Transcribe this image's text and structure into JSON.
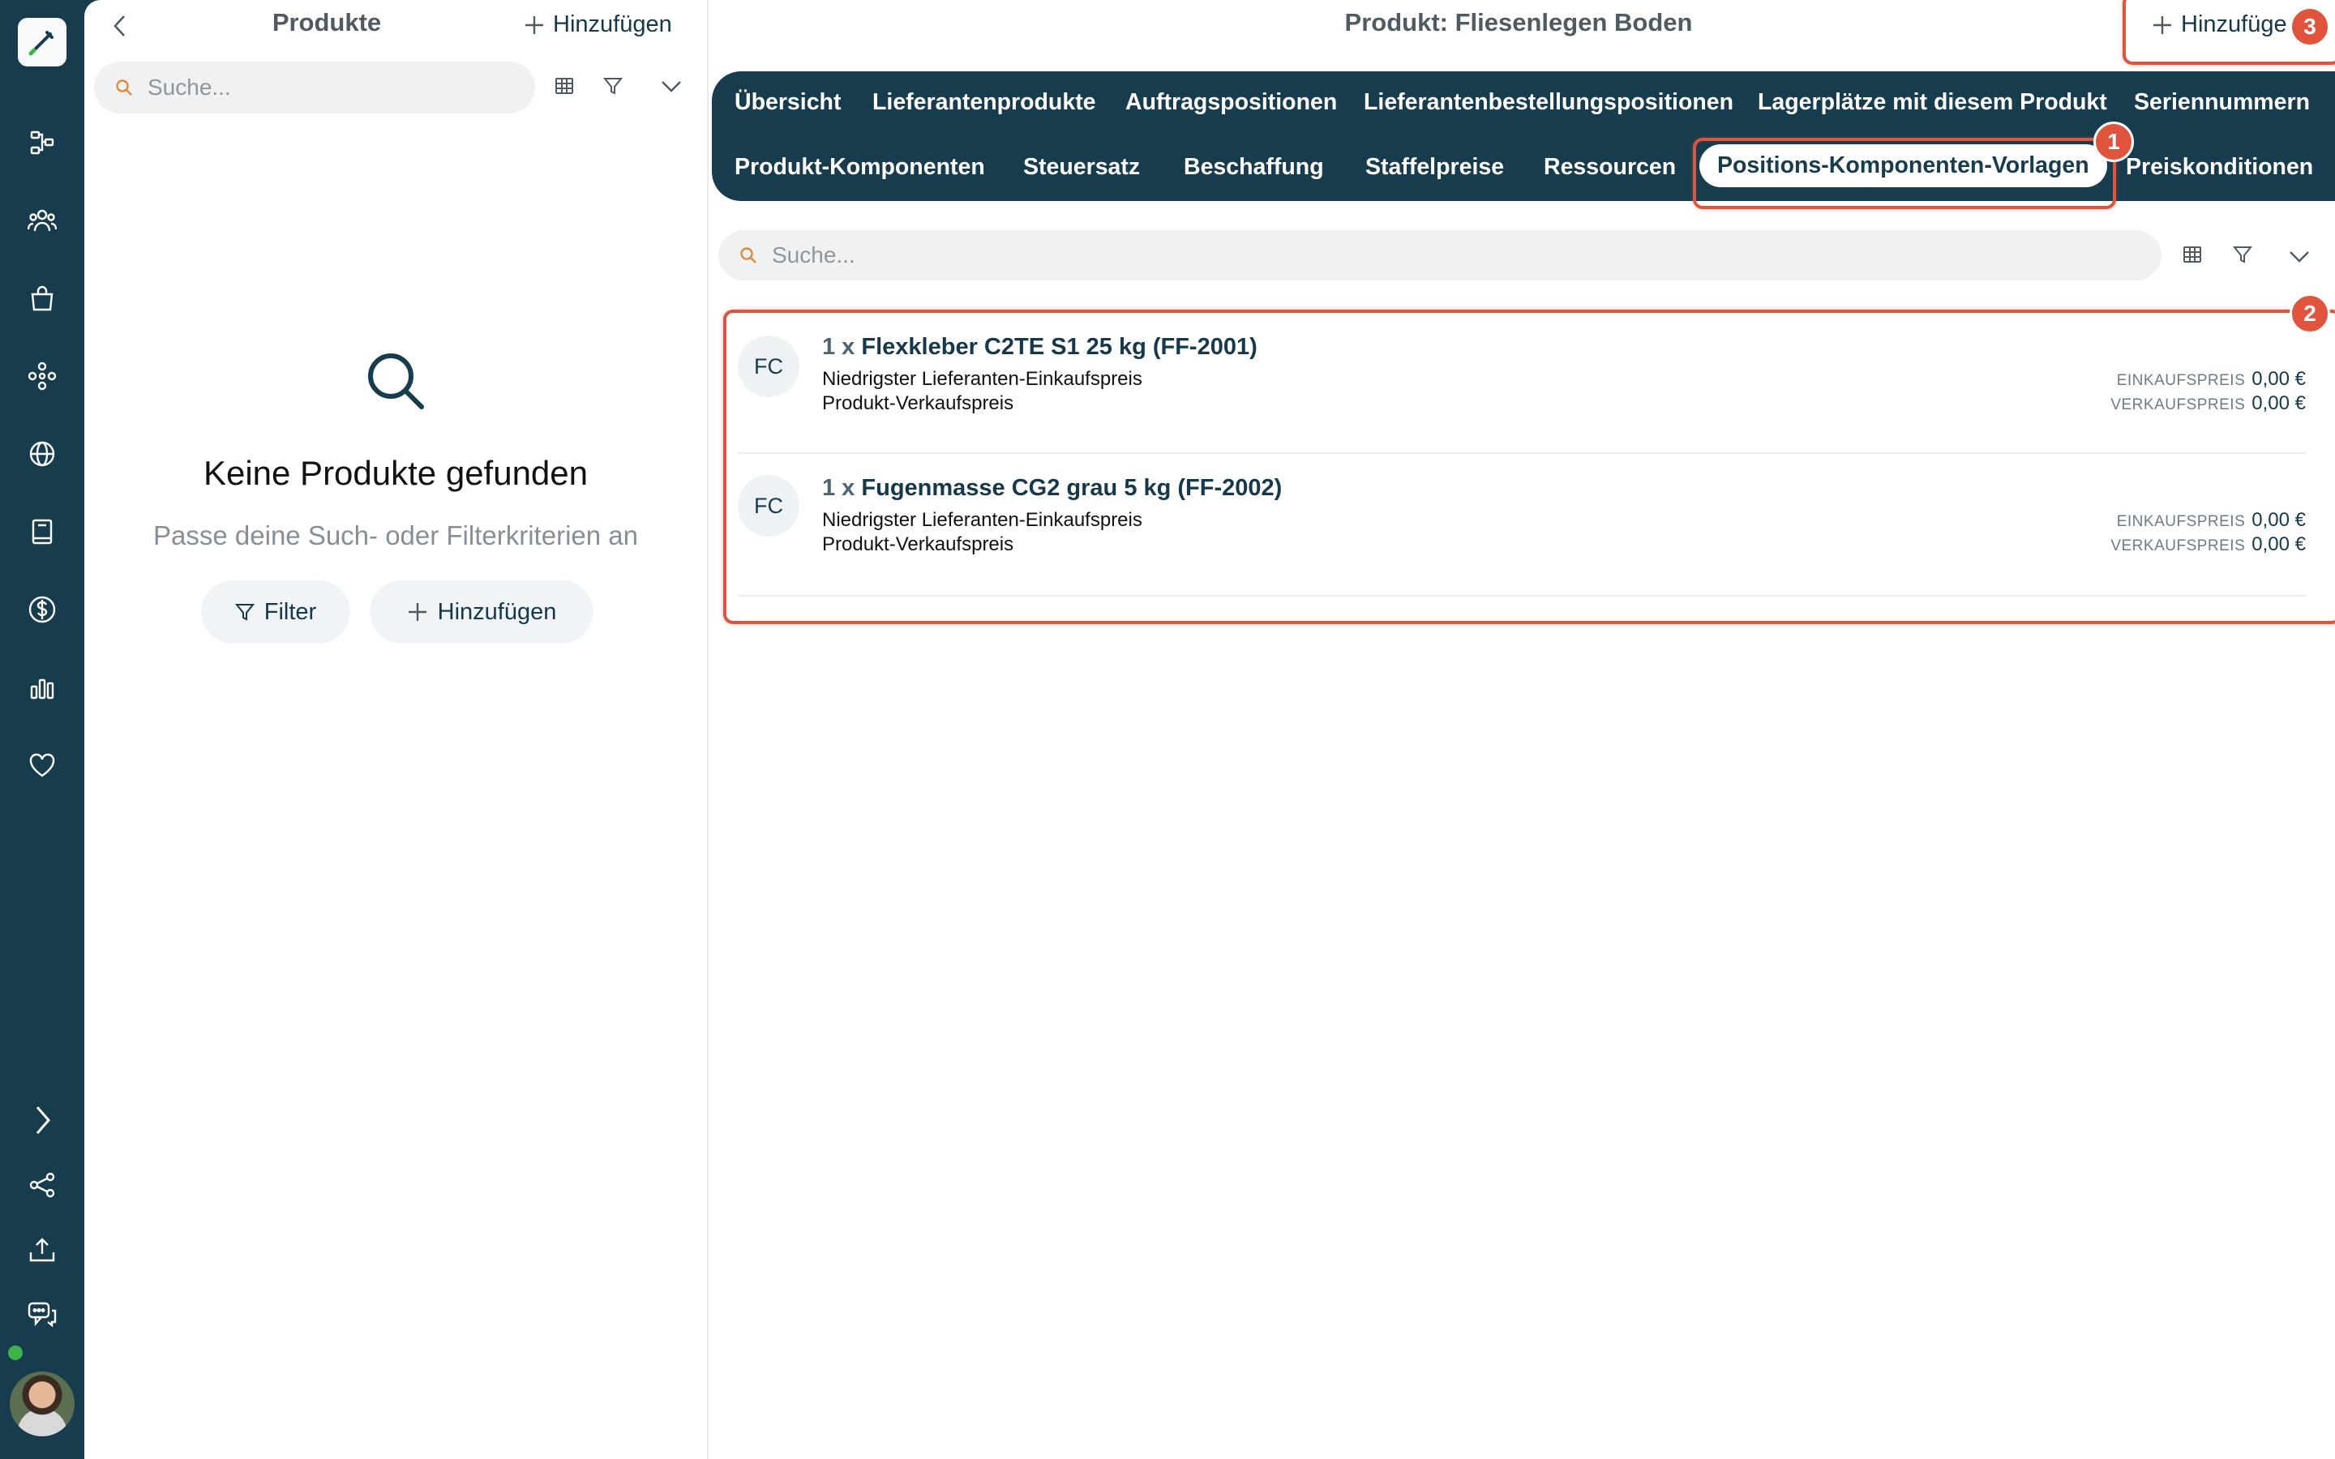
{
  "colors": {
    "rail": "#173c4e",
    "accent": "#e0533d",
    "text": "#15384a"
  },
  "rail": {
    "icons": [
      "brush-logo-icon",
      "workflow-icon",
      "users-icon",
      "shopping-bag-icon",
      "modules-icon",
      "globe-icon",
      "book-icon",
      "dollar-icon",
      "bar-chart-icon",
      "heart-icon",
      "chevron-right-icon",
      "share-icon",
      "upload-icon",
      "chat-icon"
    ]
  },
  "list": {
    "title": "Produkte",
    "add_label": "Hinzufügen",
    "search_placeholder": "Suche...",
    "empty": {
      "title": "Keine Produkte gefunden",
      "subtitle": "Passe deine Such- oder Filterkriterien an",
      "filter_label": "Filter",
      "add_label": "Hinzufügen"
    }
  },
  "main": {
    "title": "Produkt: Fliesenlegen Boden",
    "add_label": "Hinzufüge",
    "search_placeholder": "Suche...",
    "tabs_row1": [
      "Übersicht",
      "Lieferantenprodukte",
      "Auftragspositionen",
      "Lieferantenbestellungspositionen",
      "Lagerplätze mit diesem Produkt",
      "Seriennummern"
    ],
    "tabs_row2": [
      "Produkt-Komponenten",
      "Steuersatz",
      "Beschaffung",
      "Staffelpreise",
      "Ressourcen",
      "Positions-Komponenten-Vorlagen",
      "Preiskonditionen"
    ],
    "active_tab": "Positions-Komponenten-Vorlagen",
    "items": [
      {
        "initials": "FC",
        "qty": "1 x",
        "name": "Flexkleber C2TE S1 25 kg (FF-2001)",
        "line1": "Niedrigster Lieferanten-Einkaufspreis",
        "line2": "Produkt-Verkaufspreis",
        "purchase_label": "EINKAUFSPREIS",
        "purchase_value": "0,00 €",
        "sales_label": "VERKAUFSPREIS",
        "sales_value": "0,00 €"
      },
      {
        "initials": "FC",
        "qty": "1 x",
        "name": "Fugenmasse CG2 grau 5 kg (FF-2002)",
        "line1": "Niedrigster Lieferanten-Einkaufspreis",
        "line2": "Produkt-Verkaufspreis",
        "purchase_label": "EINKAUFSPREIS",
        "purchase_value": "0,00 €",
        "sales_label": "VERKAUFSPREIS",
        "sales_value": "0,00 €"
      }
    ]
  },
  "annotations": {
    "marker1": "1",
    "marker2": "2",
    "marker3": "3"
  }
}
